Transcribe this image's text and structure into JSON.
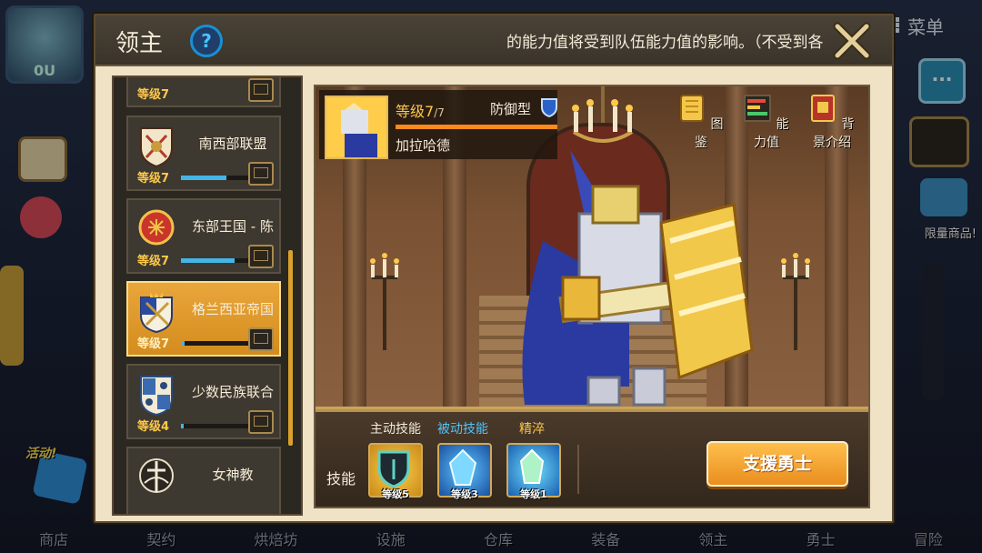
{
  "background": {
    "menu_label": "菜单",
    "limited_label": "限量商品!",
    "event_label": "活动!",
    "bottom_nav": [
      "商店",
      "契约",
      "烘焙坊",
      "设施",
      "仓库",
      "装备",
      "领主",
      "勇士",
      "冒险"
    ]
  },
  "dialog": {
    "title": "领主",
    "marquee": "的能力值将受到队伍能力值的影响。（不受到各"
  },
  "lord_list": [
    {
      "name": "",
      "level": "等级7",
      "progress": 0,
      "selected": false
    },
    {
      "name": "南西部联盟",
      "level": "等级7",
      "progress": 0.6,
      "selected": false
    },
    {
      "name": "东部王国 - 陈",
      "level": "等级7",
      "progress": 0.7,
      "selected": false
    },
    {
      "name": "格兰西亚帝国",
      "level": "等级7",
      "progress": 0.05,
      "selected": true
    },
    {
      "name": "少数民族联合",
      "level": "等级4",
      "progress": 0.03,
      "selected": false
    },
    {
      "name": "女神教",
      "level": "",
      "progress": 0,
      "selected": false
    }
  ],
  "hero": {
    "level": "等级7",
    "level_max": "/7",
    "type": "防御型",
    "name": "加拉哈德",
    "xp_progress": 1.0
  },
  "actions": [
    {
      "icon": "book-icon",
      "label": "图鉴"
    },
    {
      "icon": "stats-icon",
      "label": "能力值"
    },
    {
      "icon": "story-book-icon",
      "label": "背景介绍"
    }
  ],
  "skills": {
    "label": "技能",
    "headers": [
      {
        "label": "主动技能",
        "color": "#f4ead8"
      },
      {
        "label": "被动技能",
        "color": "#4fc3ff"
      },
      {
        "label": "精淬",
        "color": "#ffc84a"
      }
    ],
    "items": [
      {
        "icon": "dark-shield-skill-icon",
        "level": "等级5"
      },
      {
        "icon": "blue-crystal-skill-icon",
        "level": "等级3"
      },
      {
        "icon": "ice-crystal-skill-icon",
        "level": "等级1"
      }
    ]
  },
  "support_button": "支援勇士",
  "colors": {
    "accent": "#e98e1f",
    "level_text": "#ffc84a",
    "progress_blue": "#43b6e6"
  }
}
